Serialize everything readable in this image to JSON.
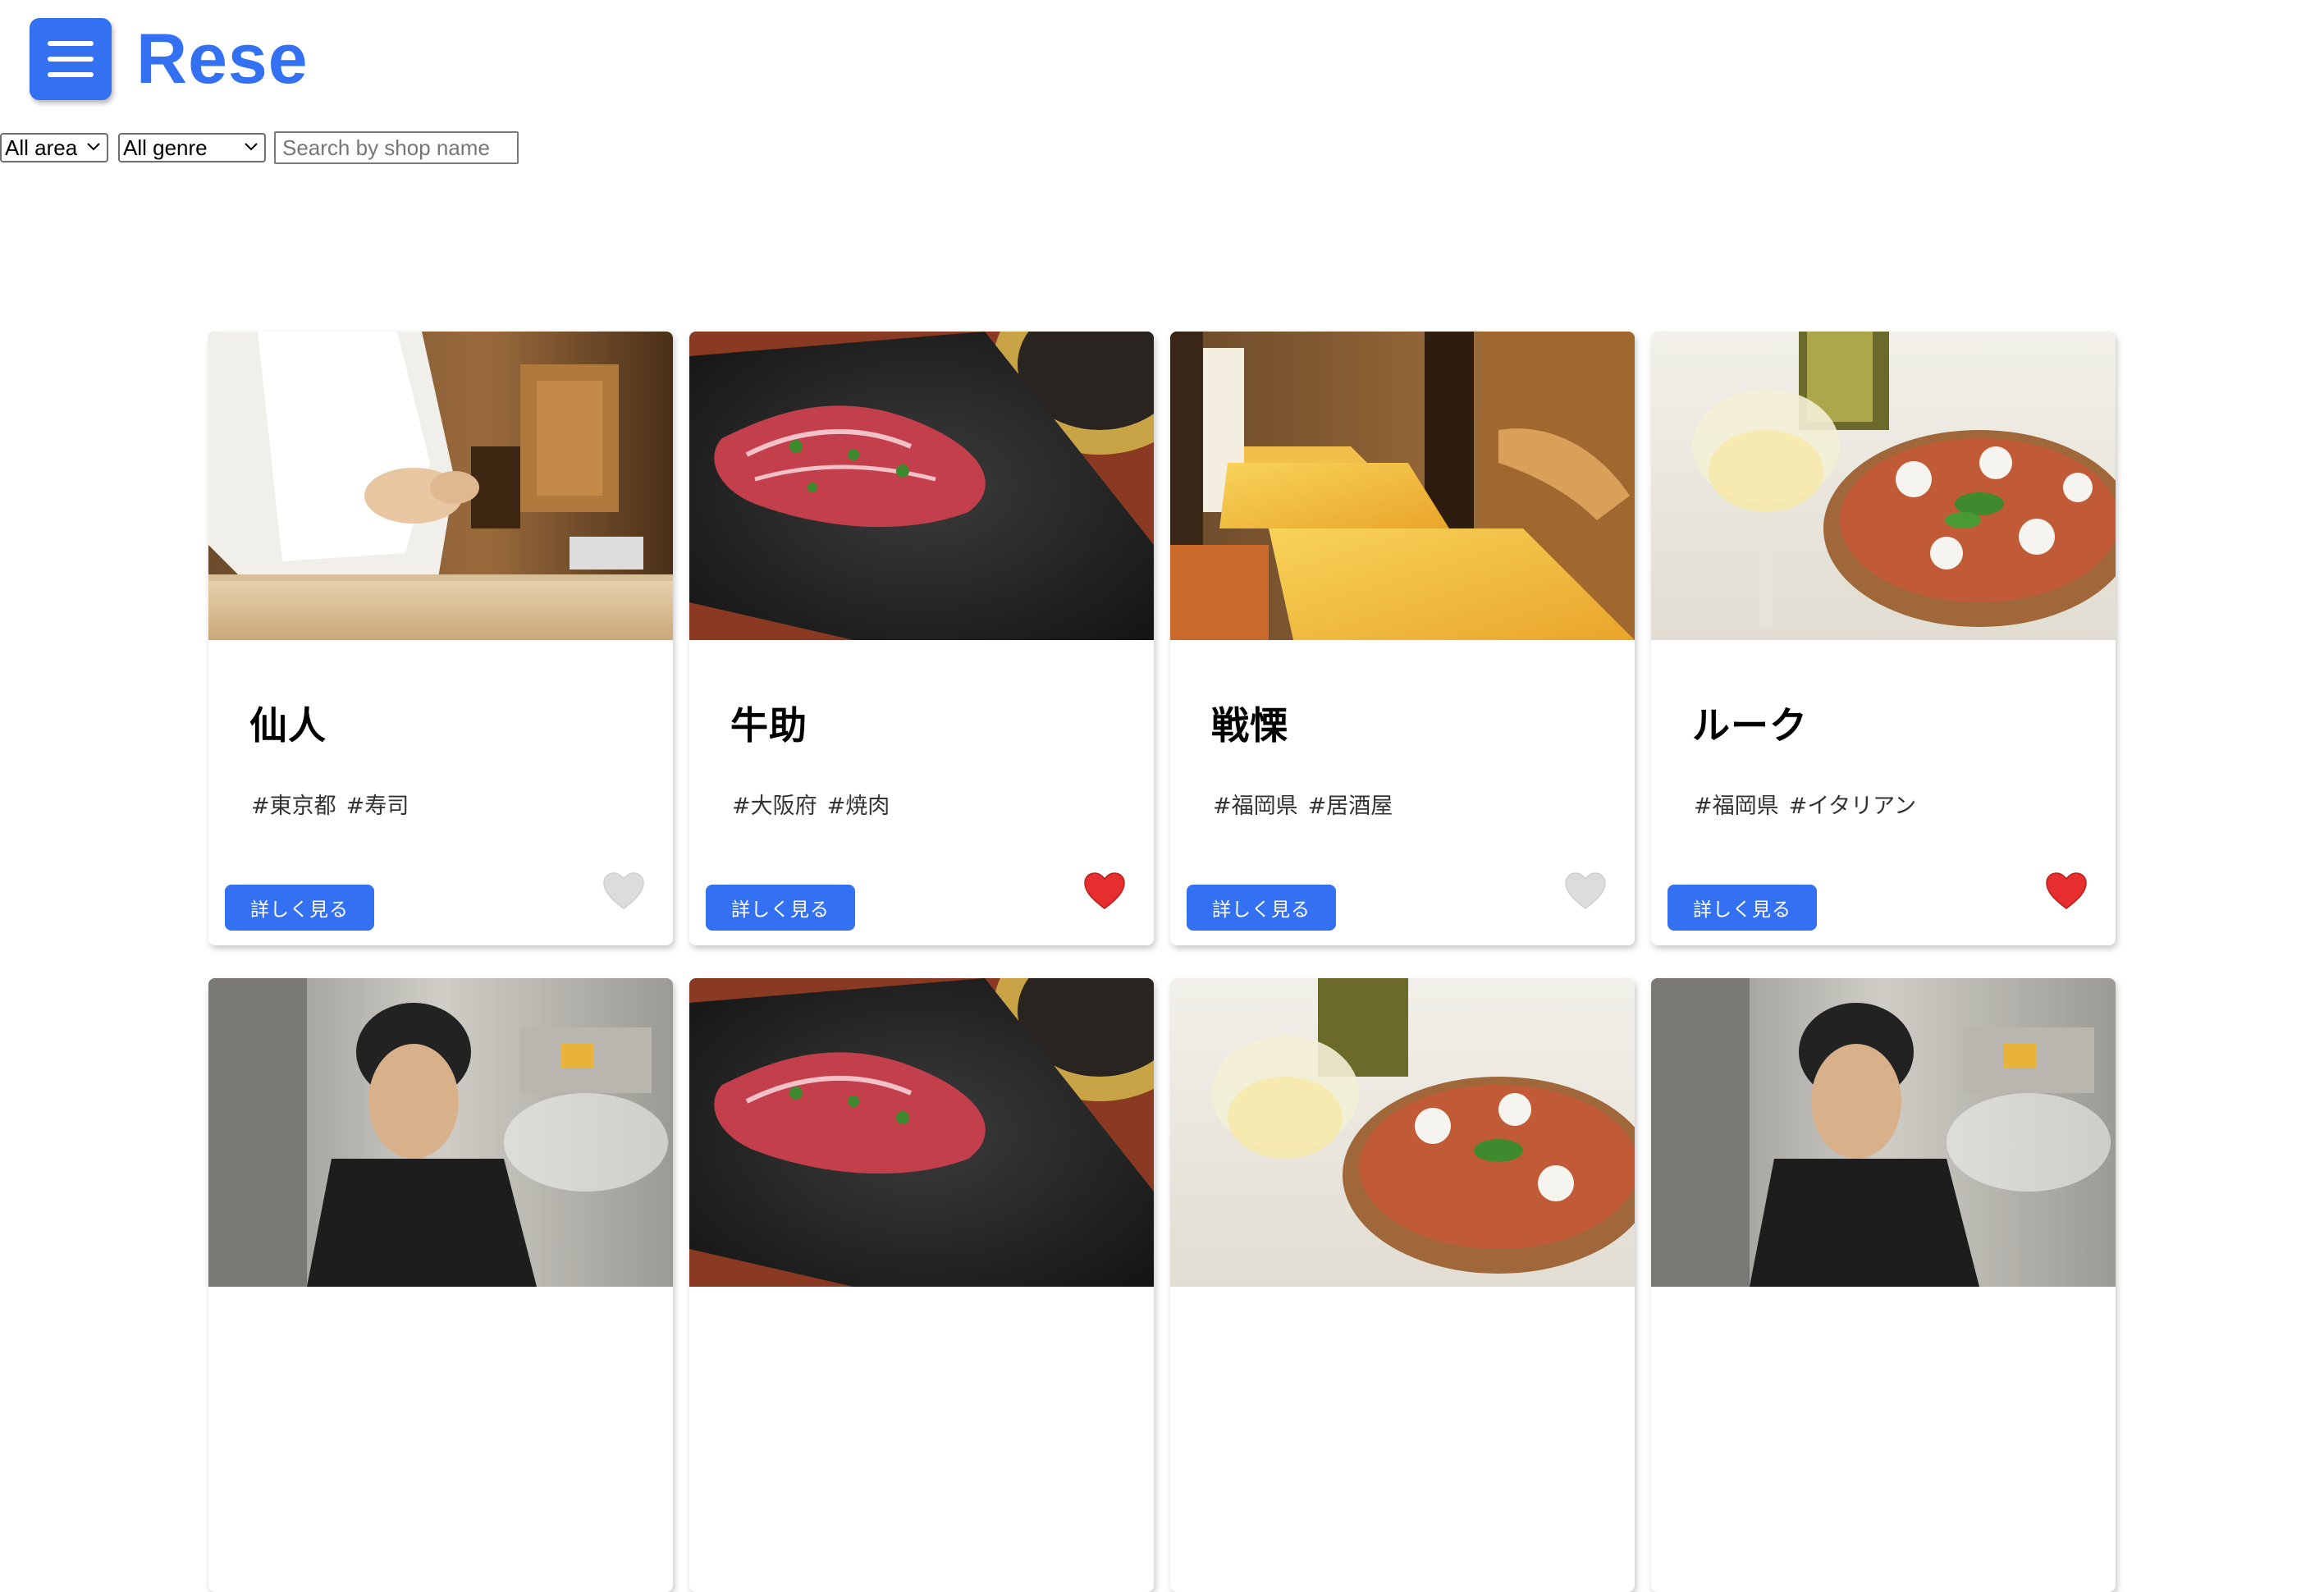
{
  "header": {
    "title": "Rese",
    "menu_icon": "hamburger-menu-icon",
    "accent_color": "#3370f2"
  },
  "filters": {
    "area_selected": "All area",
    "genre_selected": "All genre",
    "search_placeholder": "Search by shop name",
    "search_value": ""
  },
  "detail_label": "詳しく見る",
  "shops": [
    {
      "name": "仙人",
      "area": "#東京都",
      "genre": "#寿司",
      "favorite": false,
      "photo": "sushi-chef"
    },
    {
      "name": "牛助",
      "area": "#大阪府",
      "genre": "#焼肉",
      "favorite": true,
      "photo": "yakiniku-beef"
    },
    {
      "name": "戦慄",
      "area": "#福岡県",
      "genre": "#居酒屋",
      "favorite": false,
      "photo": "izakaya-interior"
    },
    {
      "name": "ルーク",
      "area": "#福岡県",
      "genre": "#イタリアン",
      "favorite": true,
      "photo": "pizza-wine"
    }
  ],
  "shops_row2_photos": [
    "kitchen-cook",
    "yakiniku-beef",
    "pizza-wine",
    "kitchen-cook"
  ],
  "colors": {
    "favorite_on": "#e62e2e",
    "favorite_off": "#d9d9d9",
    "button": "#3370f2"
  }
}
